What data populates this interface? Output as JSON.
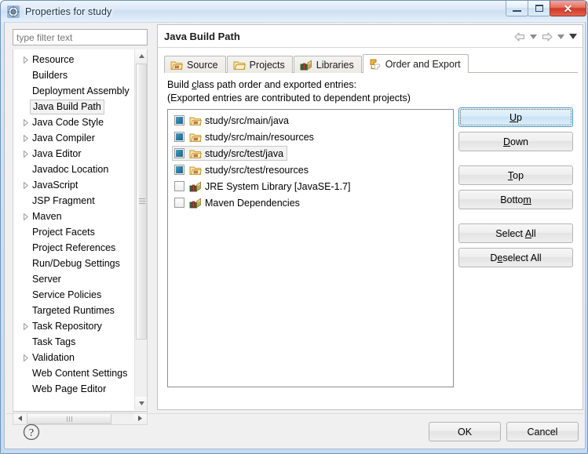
{
  "window": {
    "title": "Properties for study",
    "icon": "properties-gear-icon",
    "buttons": {
      "minimize": "minimize-icon",
      "maximize": "maximize-icon",
      "close": "close-icon"
    }
  },
  "sidebar": {
    "filter": {
      "placeholder": "type filter text",
      "value": ""
    },
    "items": [
      {
        "label": "Resource",
        "expandable": true,
        "selected": false
      },
      {
        "label": "Builders",
        "expandable": false,
        "selected": false
      },
      {
        "label": "Deployment Assembly",
        "expandable": false,
        "selected": false
      },
      {
        "label": "Java Build Path",
        "expandable": false,
        "selected": true
      },
      {
        "label": "Java Code Style",
        "expandable": true,
        "selected": false
      },
      {
        "label": "Java Compiler",
        "expandable": true,
        "selected": false
      },
      {
        "label": "Java Editor",
        "expandable": true,
        "selected": false
      },
      {
        "label": "Javadoc Location",
        "expandable": false,
        "selected": false
      },
      {
        "label": "JavaScript",
        "expandable": true,
        "selected": false
      },
      {
        "label": "JSP Fragment",
        "expandable": false,
        "selected": false
      },
      {
        "label": "Maven",
        "expandable": true,
        "selected": false
      },
      {
        "label": "Project Facets",
        "expandable": false,
        "selected": false
      },
      {
        "label": "Project References",
        "expandable": false,
        "selected": false
      },
      {
        "label": "Run/Debug Settings",
        "expandable": false,
        "selected": false
      },
      {
        "label": "Server",
        "expandable": false,
        "selected": false
      },
      {
        "label": "Service Policies",
        "expandable": false,
        "selected": false
      },
      {
        "label": "Targeted Runtimes",
        "expandable": false,
        "selected": false
      },
      {
        "label": "Task Repository",
        "expandable": true,
        "selected": false
      },
      {
        "label": "Task Tags",
        "expandable": false,
        "selected": false
      },
      {
        "label": "Validation",
        "expandable": true,
        "selected": false
      },
      {
        "label": "Web Content Settings",
        "expandable": false,
        "selected": false
      },
      {
        "label": "Web Page Editor",
        "expandable": false,
        "selected": false
      }
    ]
  },
  "page": {
    "title": "Java Build Path",
    "nav": {
      "back": "back-arrow-icon",
      "back_menu": "chevron-down-icon",
      "forward": "forward-arrow-icon",
      "forward_menu": "chevron-down-icon",
      "view_menu": "chevron-down-icon"
    }
  },
  "tabs": [
    {
      "label": "Source",
      "icon": "source-folder-icon",
      "active": false
    },
    {
      "label": "Projects",
      "icon": "projects-folder-icon",
      "active": false
    },
    {
      "label": "Libraries",
      "icon": "libraries-books-icon",
      "active": false
    },
    {
      "label": "Order and Export",
      "icon": "order-export-icon",
      "active": true
    }
  ],
  "content": {
    "description_line1_pre": "Build ",
    "description_line1_mnemonic": "c",
    "description_line1_post": "lass path order and exported entries:",
    "description_line2": "(Exported entries are contributed to dependent projects)",
    "entries": [
      {
        "label": "study/src/main/java",
        "checked": true,
        "selected": false,
        "icon": "source-folder-icon"
      },
      {
        "label": "study/src/main/resources",
        "checked": true,
        "selected": false,
        "icon": "source-folder-icon"
      },
      {
        "label": "study/src/test/java",
        "checked": true,
        "selected": true,
        "icon": "source-folder-icon"
      },
      {
        "label": "study/src/test/resources",
        "checked": true,
        "selected": false,
        "icon": "source-folder-icon"
      },
      {
        "label": "JRE System Library [JavaSE-1.7]",
        "checked": false,
        "selected": false,
        "icon": "library-icon"
      },
      {
        "label": "Maven Dependencies",
        "checked": false,
        "selected": false,
        "icon": "library-icon"
      }
    ]
  },
  "side_buttons": [
    {
      "pre": "",
      "mnemonic": "U",
      "post": "p",
      "default": true,
      "gap": false
    },
    {
      "pre": "",
      "mnemonic": "D",
      "post": "own",
      "default": false,
      "gap": true
    },
    {
      "pre": "",
      "mnemonic": "T",
      "post": "op",
      "default": false,
      "gap": false
    },
    {
      "pre": "Botto",
      "mnemonic": "m",
      "post": "",
      "default": false,
      "gap": true
    },
    {
      "pre": "Select ",
      "mnemonic": "A",
      "post": "ll",
      "default": false,
      "gap": false
    },
    {
      "pre": "D",
      "mnemonic": "e",
      "post": "select All",
      "default": false,
      "gap": false
    }
  ],
  "footer": {
    "help": "help-icon",
    "ok": "OK",
    "cancel": "Cancel"
  },
  "colors": {
    "accent": "#2c7fa5",
    "title_text": "#17334d",
    "default_button_border": "#3c98c9",
    "close_button": "#cf3a27"
  }
}
